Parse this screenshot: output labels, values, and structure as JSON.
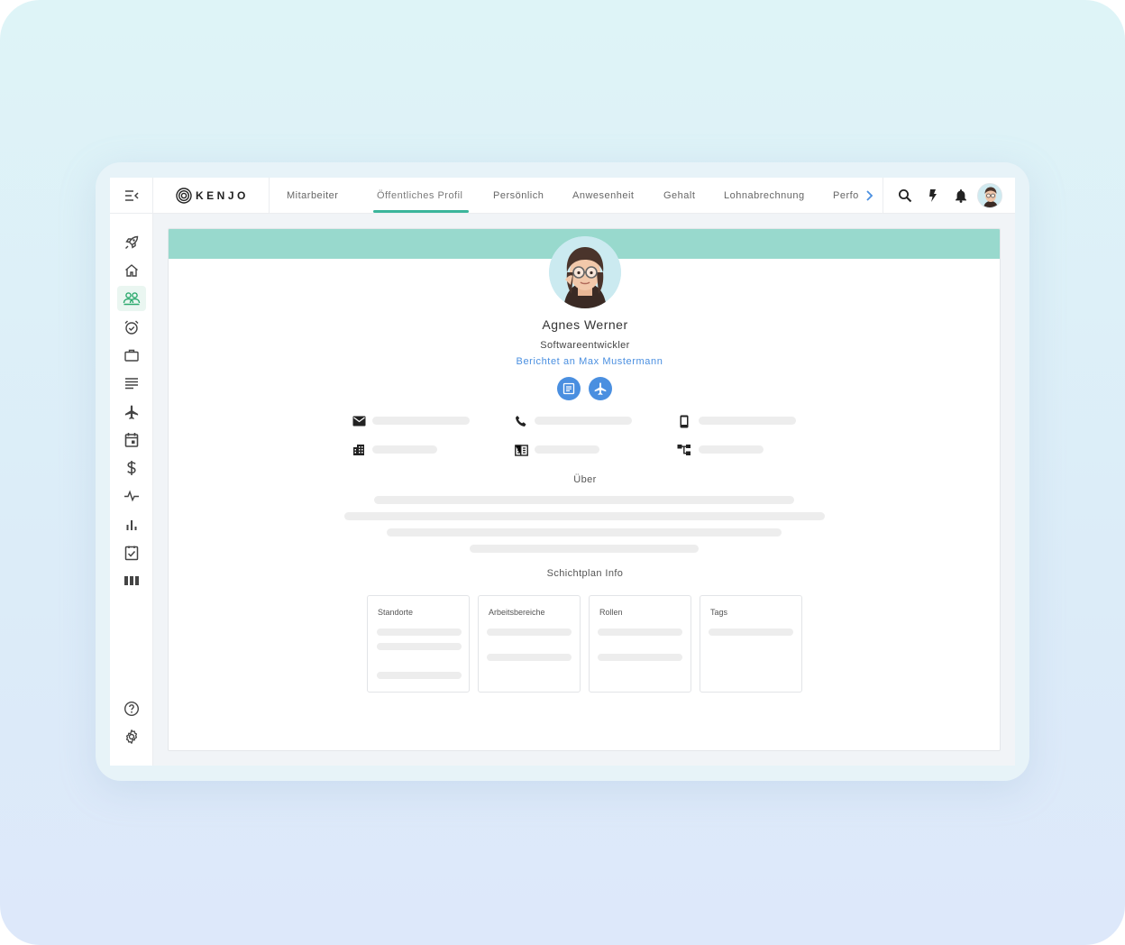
{
  "app": {
    "logo": "KENJO"
  },
  "tabs": [
    {
      "label": "Mitarbeiter"
    },
    {
      "label": "Öffentliches Profil",
      "active": true
    },
    {
      "label": "Persönlich"
    },
    {
      "label": "Anwesenheit"
    },
    {
      "label": "Gehalt"
    },
    {
      "label": "Lohnabrechnung"
    },
    {
      "label": "Perfo"
    }
  ],
  "topbar_icons": [
    "search-icon",
    "lightning-icon",
    "bell-icon",
    "user-avatar"
  ],
  "sidebar_icons": [
    "rocket-icon",
    "home-icon",
    "people-icon",
    "alarm-icon",
    "briefcase-icon",
    "list-icon",
    "airplane-icon",
    "calendar-icon",
    "dollar-icon",
    "pulse-icon",
    "bar-chart-icon",
    "checklist-icon",
    "columns-icon",
    "help-icon",
    "settings-icon"
  ],
  "profile": {
    "name": "Agnes Werner",
    "job_title": "Softwareentwickler",
    "reports_to": "Berichtet an Max Mustermann",
    "action_icons": [
      "document-icon",
      "airplane-icon"
    ]
  },
  "contact_icons": [
    "mail-icon",
    "phone-icon",
    "mobile-icon",
    "building-icon",
    "company-icon",
    "org-chart-icon"
  ],
  "about": {
    "title": "Über"
  },
  "shift_plan": {
    "title": "Schichtplan Info",
    "boxes": [
      {
        "label": "Standorte"
      },
      {
        "label": "Arbeitsbereiche"
      },
      {
        "label": "Rollen"
      },
      {
        "label": "Tags"
      }
    ]
  },
  "colors": {
    "accent": "#3bb59b",
    "banner": "#98d9cd",
    "link": "#4a8fe0",
    "active_sidebar": "#2eaa6f"
  }
}
